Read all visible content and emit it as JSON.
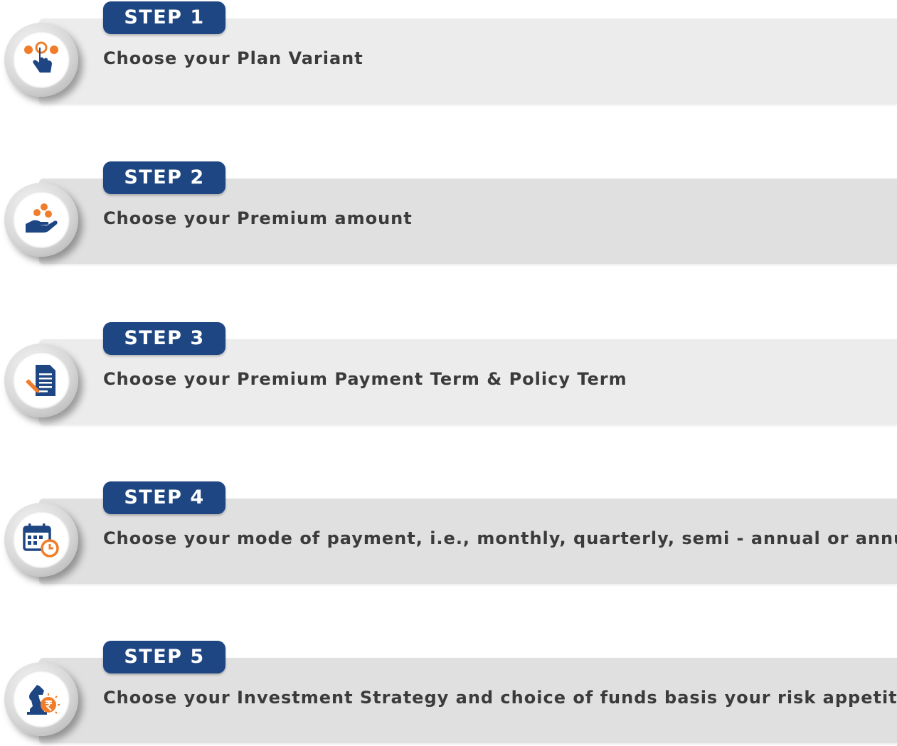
{
  "colors": {
    "badge_bg": "#1e4683",
    "icon_blue": "#1e4683",
    "icon_orange": "#ef7d2a",
    "text": "#3b3b3b"
  },
  "steps": [
    {
      "badge": "STEP 1",
      "text": "Choose your Plan Variant",
      "icon": "finger-tap-icon"
    },
    {
      "badge": "STEP 2",
      "text": "Choose your Premium amount",
      "icon": "hand-coins-icon"
    },
    {
      "badge": "STEP 3",
      "text": "Choose your Premium Payment Term & Policy Term",
      "icon": "document-pen-icon"
    },
    {
      "badge": "STEP 4",
      "text": "Choose your mode of payment, i.e., monthly, quarterly, semi - annual or annual",
      "icon": "calendar-clock-icon"
    },
    {
      "badge": "STEP 5",
      "text": "Choose your Investment Strategy and choice of funds basis your risk appetite",
      "icon": "chess-knight-rupee-icon"
    }
  ]
}
